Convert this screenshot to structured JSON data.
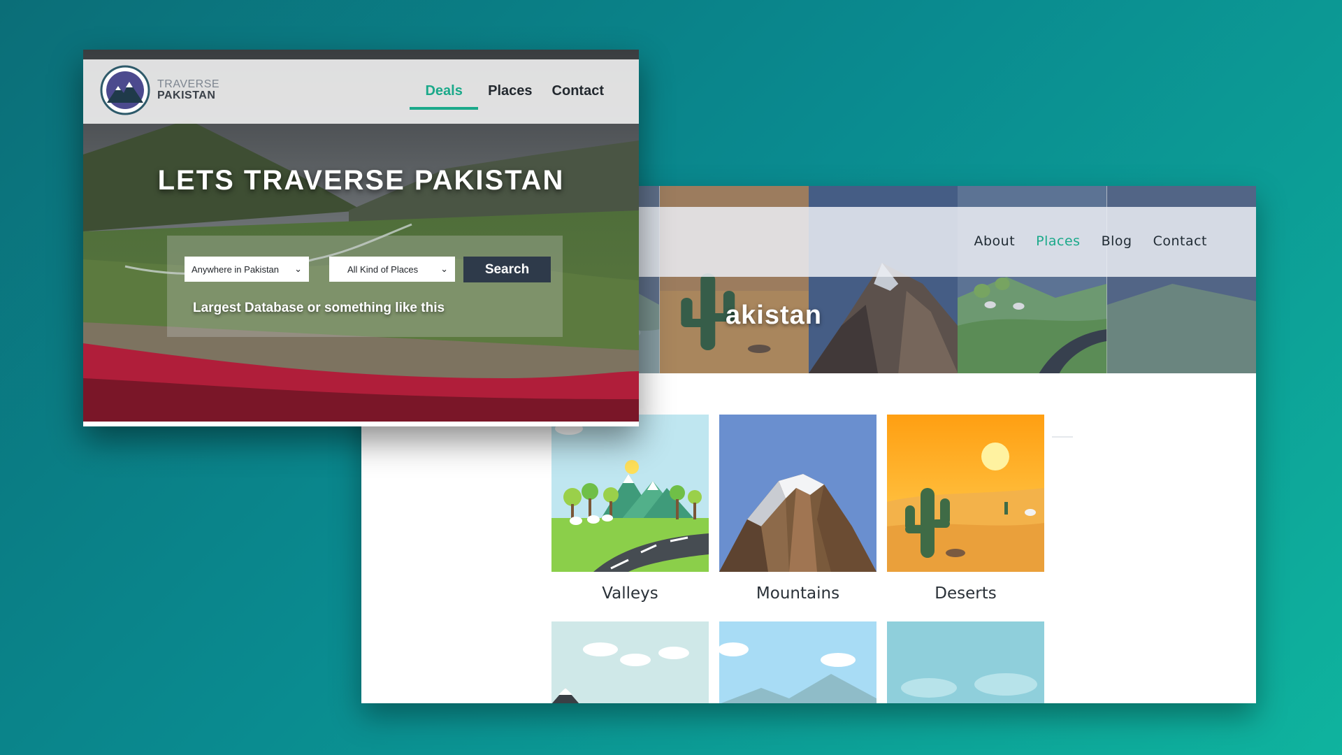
{
  "colors": {
    "accent": "#1ba98a",
    "button": "#2e3a4a",
    "background_start": "#0b6e78",
    "background_end": "#0fb39e"
  },
  "front": {
    "logo": {
      "line1": "TRAVERSE",
      "line2": "PAKISTAN",
      "icon": "mountain-badge-icon"
    },
    "nav": {
      "items": [
        {
          "label": "Deals",
          "active": true
        },
        {
          "label": "Places",
          "active": false
        },
        {
          "label": "Contact",
          "active": false
        }
      ]
    },
    "hero": {
      "title": "LETS TRAVERSE PAKISTAN"
    },
    "search": {
      "location_value": "Anywhere in Pakistan",
      "type_value": "All Kind of Places",
      "button_label": "Search",
      "subtitle": "Largest Database or something like this"
    }
  },
  "back": {
    "nav": {
      "items": [
        {
          "label": "About",
          "active": false
        },
        {
          "label": "Places",
          "active": true
        },
        {
          "label": "Blog",
          "active": false
        },
        {
          "label": "Contact",
          "active": false
        }
      ]
    },
    "hero": {
      "title_fragment": "akistan"
    },
    "categories": [
      {
        "label": "Valleys",
        "icon": "valley-illustration"
      },
      {
        "label": "Mountains",
        "icon": "mountain-illustration"
      },
      {
        "label": "Deserts",
        "icon": "desert-illustration"
      }
    ]
  }
}
